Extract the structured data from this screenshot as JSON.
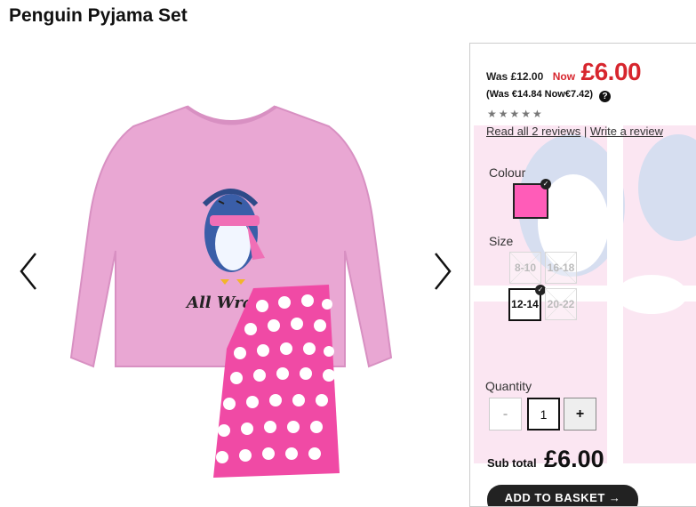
{
  "product": {
    "title": "Penguin Pyjama Set"
  },
  "gallery": {
    "prev_icon": "chevron-left-icon",
    "next_icon": "chevron-right-icon"
  },
  "price": {
    "was": "Was £12.00",
    "now_label": "Now",
    "now": "£6.00",
    "euro": "(Was €14.84 Now€7.42)",
    "help_icon": "?",
    "accent_color": "#d7262e"
  },
  "rating": {
    "stars": "★★★★★",
    "value": 0,
    "max": 5
  },
  "reviews": {
    "read_all": "Read all 2 reviews",
    "separator": "|",
    "write": "Write a review"
  },
  "colour": {
    "label": "Colour",
    "selected_color": "#ff5cb8"
  },
  "size": {
    "label": "Size",
    "options": [
      {
        "label": "8-10",
        "available": false,
        "selected": false
      },
      {
        "label": "16-18",
        "available": false,
        "selected": false
      },
      {
        "label": "12-14",
        "available": true,
        "selected": true
      },
      {
        "label": "20-22",
        "available": false,
        "selected": false
      }
    ]
  },
  "quantity": {
    "label": "Quantity",
    "minus": "-",
    "value": "1",
    "plus": "+"
  },
  "subtotal": {
    "label": "Sub total",
    "value": "£6.00"
  },
  "basket": {
    "label": "ADD TO BASKET →"
  }
}
